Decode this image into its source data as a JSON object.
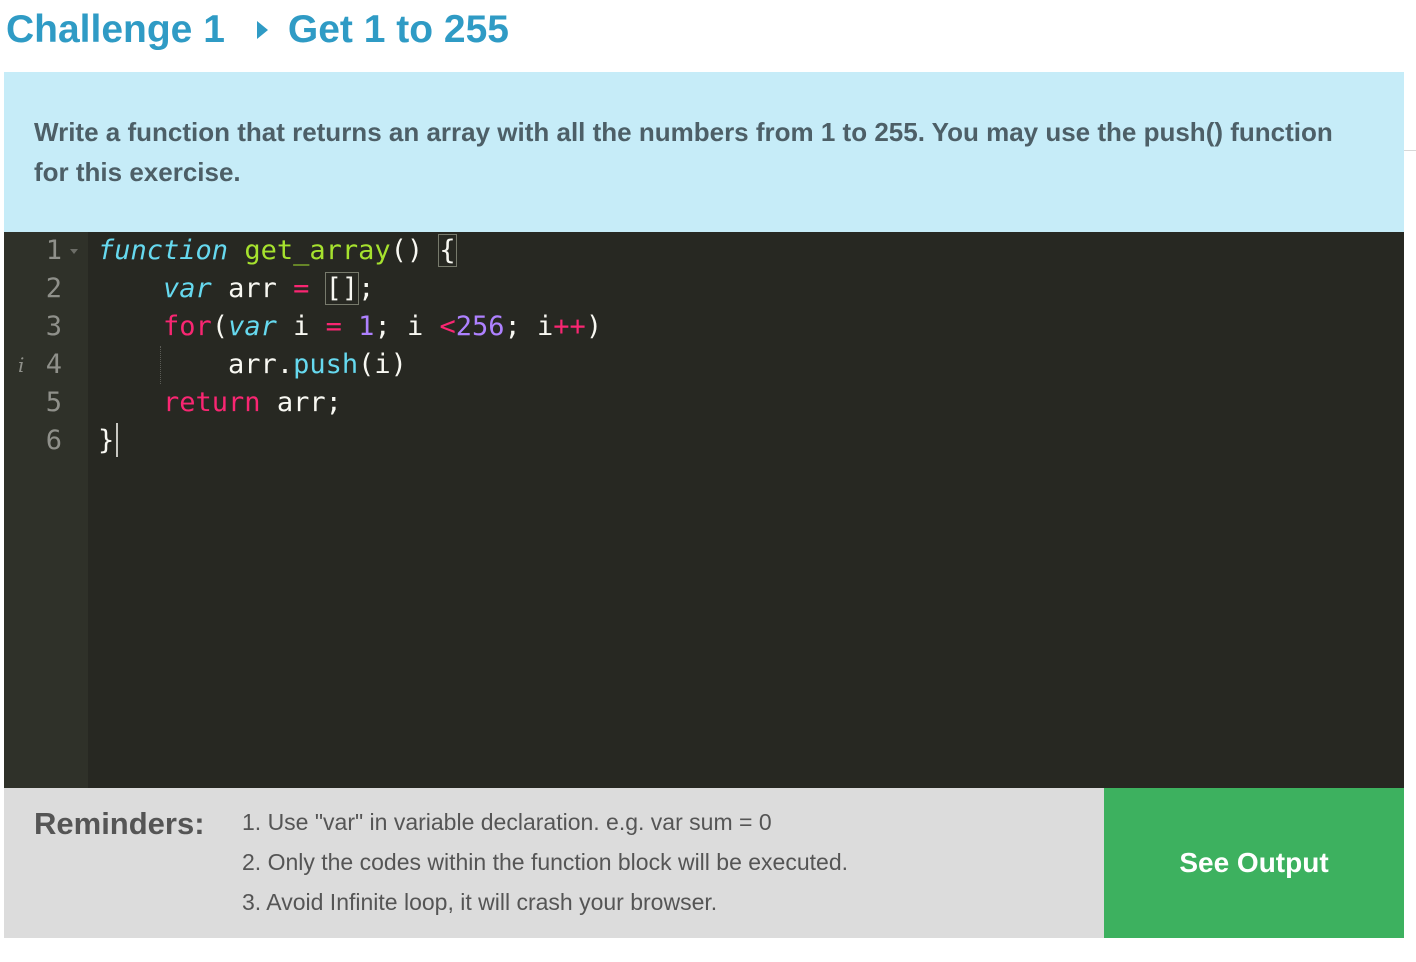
{
  "header": {
    "challenge": "Challenge 1",
    "title": "Get 1 to 255"
  },
  "prompt": {
    "text": "Write a function that returns an array with all the numbers from 1 to 255. You may use the push() function for this exercise."
  },
  "editor": {
    "line_numbers": [
      "1",
      "2",
      "3",
      "4",
      "5",
      "6"
    ],
    "info_marker": "i",
    "code": {
      "l1": {
        "kw": "function",
        "name": "get_array",
        "rest": "() ",
        "brace": "{"
      },
      "l2": {
        "indent": "    ",
        "kw": "var",
        "ident": " arr ",
        "op": "=",
        "sp": " ",
        "arr": "[]",
        "end": ";"
      },
      "l3": {
        "indent": "    ",
        "kw1": "for",
        "p1": "(",
        "kw2": "var",
        "i1": " i ",
        "op1": "=",
        "sp1": " ",
        "n1": "1",
        "s1": "; i ",
        "op2": "<",
        "n2": "256",
        "s2": "; i",
        "op3": "++",
        "p2": ")"
      },
      "l4": {
        "indent": "        ",
        "obj": "arr.",
        "method": "push",
        "args": "(i)"
      },
      "l5": {
        "indent": "    ",
        "kw": "return",
        "rest": " arr;"
      },
      "l6": {
        "brace": "}"
      }
    }
  },
  "reminders": {
    "title": "Reminders:",
    "items": [
      "1. Use \"var\" in variable declaration. e.g. var sum = 0",
      "2. Only the codes within the function block will be executed.",
      "3. Avoid Infinite loop, it will crash your browser."
    ]
  },
  "actions": {
    "see_output": "See Output"
  },
  "colors": {
    "heading": "#2f9bc5",
    "prompt_bg": "#c6ecf8",
    "editor_bg": "#272822",
    "keyword": "#f92672",
    "storage": "#66d9ef",
    "function_name": "#a6e22e",
    "number": "#ae81ff",
    "button": "#3db15f"
  }
}
